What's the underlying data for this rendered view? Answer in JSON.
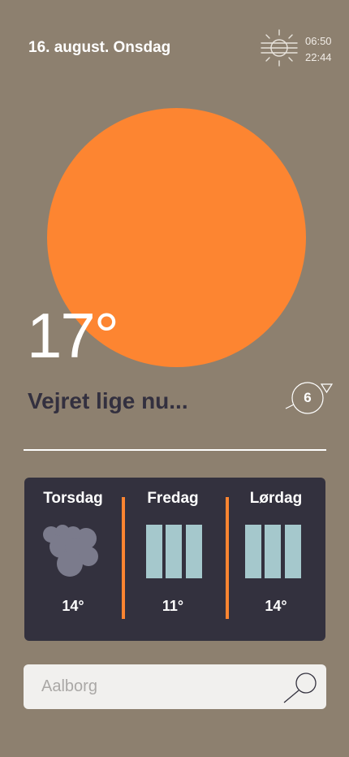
{
  "header": {
    "date": "16. august. Onsdag",
    "sunrise": "06:50",
    "sunset": "22:44",
    "icon": "sunrise-sunset-icon"
  },
  "current": {
    "temperature": "17°",
    "label": "Vejret lige nu...",
    "wind": "6",
    "wind_icon": "wind-direction-icon",
    "sun_color": "#fd8531"
  },
  "forecast": {
    "days": [
      {
        "name": "Torsdag",
        "temp": "14°",
        "icon": "cloud-icon"
      },
      {
        "name": "Fredag",
        "temp": "11°",
        "icon": "rain-icon"
      },
      {
        "name": "Lørdag",
        "temp": "14°",
        "icon": "rain-icon"
      }
    ]
  },
  "search": {
    "placeholder": "Aalborg",
    "icon": "search-icon"
  },
  "colors": {
    "background": "#8d806f",
    "accent": "#fd8531",
    "panel": "#33313e",
    "rain": "#a5c8cc",
    "cloud": "#7b7b8c"
  }
}
